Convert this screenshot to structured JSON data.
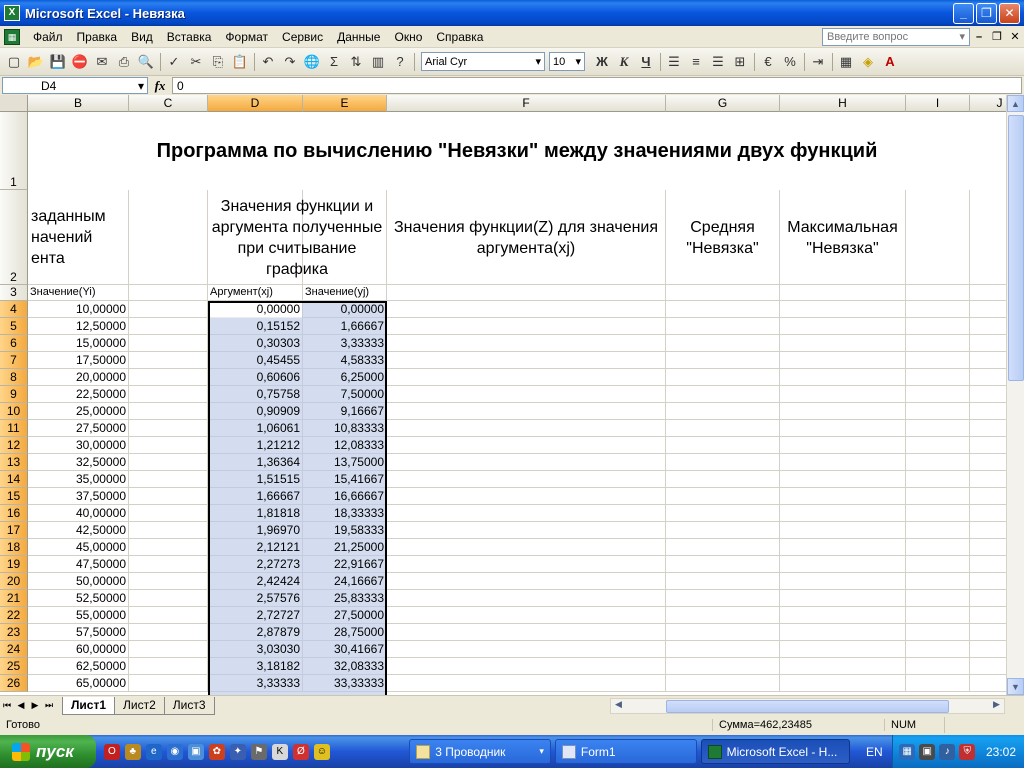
{
  "window": {
    "title": "Microsoft Excel - Невязка",
    "app_icon": "X"
  },
  "menu": {
    "items": [
      "Файл",
      "Правка",
      "Вид",
      "Вставка",
      "Формат",
      "Сервис",
      "Данные",
      "Окно",
      "Справка"
    ],
    "help_placeholder": "Введите вопрос"
  },
  "toolbar": {
    "font_name": "Arial Cyr",
    "font_size": "10",
    "sigma": "Σ",
    "bold": "Ж",
    "italic": "К",
    "underline": "Ч",
    "percent": "%"
  },
  "formula_bar": {
    "name_box": "D4",
    "fx": "fx",
    "formula": "0"
  },
  "columns": [
    "B",
    "C",
    "D",
    "E",
    "F",
    "G",
    "H",
    "I",
    "J"
  ],
  "selected_columns": [
    "D",
    "E"
  ],
  "sheet": {
    "title": "Программа по вычислению \"Невязки\" между значениями двух функций",
    "row2": {
      "b_text": "заданным\nначений\nента",
      "d_text": "Значения функции и аргумента полученные при считывание графика",
      "f_text": "Значения функции(Z) для значения аргумента(xj)",
      "g_text": "Средняя \"Невязка\"",
      "h_text": "Максимальная \"Невязка\""
    },
    "row3": {
      "b": "Значение(Yi)",
      "d": "Аргумент(xj)",
      "e": "Значение(yj)"
    },
    "rows": [
      {
        "n": "4",
        "b": "10,00000",
        "d": "0,00000",
        "e": "0,00000"
      },
      {
        "n": "5",
        "b": "12,50000",
        "d": "0,15152",
        "e": "1,66667"
      },
      {
        "n": "6",
        "b": "15,00000",
        "d": "0,30303",
        "e": "3,33333"
      },
      {
        "n": "7",
        "b": "17,50000",
        "d": "0,45455",
        "e": "4,58333"
      },
      {
        "n": "8",
        "b": "20,00000",
        "d": "0,60606",
        "e": "6,25000"
      },
      {
        "n": "9",
        "b": "22,50000",
        "d": "0,75758",
        "e": "7,50000"
      },
      {
        "n": "10",
        "b": "25,00000",
        "d": "0,90909",
        "e": "9,16667"
      },
      {
        "n": "11",
        "b": "27,50000",
        "d": "1,06061",
        "e": "10,83333"
      },
      {
        "n": "12",
        "b": "30,00000",
        "d": "1,21212",
        "e": "12,08333"
      },
      {
        "n": "13",
        "b": "32,50000",
        "d": "1,36364",
        "e": "13,75000"
      },
      {
        "n": "14",
        "b": "35,00000",
        "d": "1,51515",
        "e": "15,41667"
      },
      {
        "n": "15",
        "b": "37,50000",
        "d": "1,66667",
        "e": "16,66667"
      },
      {
        "n": "16",
        "b": "40,00000",
        "d": "1,81818",
        "e": "18,33333"
      },
      {
        "n": "17",
        "b": "42,50000",
        "d": "1,96970",
        "e": "19,58333"
      },
      {
        "n": "18",
        "b": "45,00000",
        "d": "2,12121",
        "e": "21,25000"
      },
      {
        "n": "19",
        "b": "47,50000",
        "d": "2,27273",
        "e": "22,91667"
      },
      {
        "n": "20",
        "b": "50,00000",
        "d": "2,42424",
        "e": "24,16667"
      },
      {
        "n": "21",
        "b": "52,50000",
        "d": "2,57576",
        "e": "25,83333"
      },
      {
        "n": "22",
        "b": "55,00000",
        "d": "2,72727",
        "e": "27,50000"
      },
      {
        "n": "23",
        "b": "57,50000",
        "d": "2,87879",
        "e": "28,75000"
      },
      {
        "n": "24",
        "b": "60,00000",
        "d": "3,03030",
        "e": "30,41667"
      },
      {
        "n": "25",
        "b": "62,50000",
        "d": "3,18182",
        "e": "32,08333"
      },
      {
        "n": "26",
        "b": "65,00000",
        "d": "3,33333",
        "e": "33,33333"
      }
    ]
  },
  "tabs": [
    "Лист1",
    "Лист2",
    "Лист3"
  ],
  "active_tab": "Лист1",
  "status": {
    "ready": "Готово",
    "sum": "Сумма=462,23485",
    "num": "NUM"
  },
  "taskbar": {
    "start": "пуск",
    "tasks": [
      "3 Проводник",
      "Form1",
      "Microsoft Excel - Н..."
    ],
    "lang": "EN",
    "clock": "23:02"
  },
  "colors": {
    "selection": "#a0b4dc",
    "header_selected": "#f4a93e",
    "title_bar": "#0855dd"
  }
}
